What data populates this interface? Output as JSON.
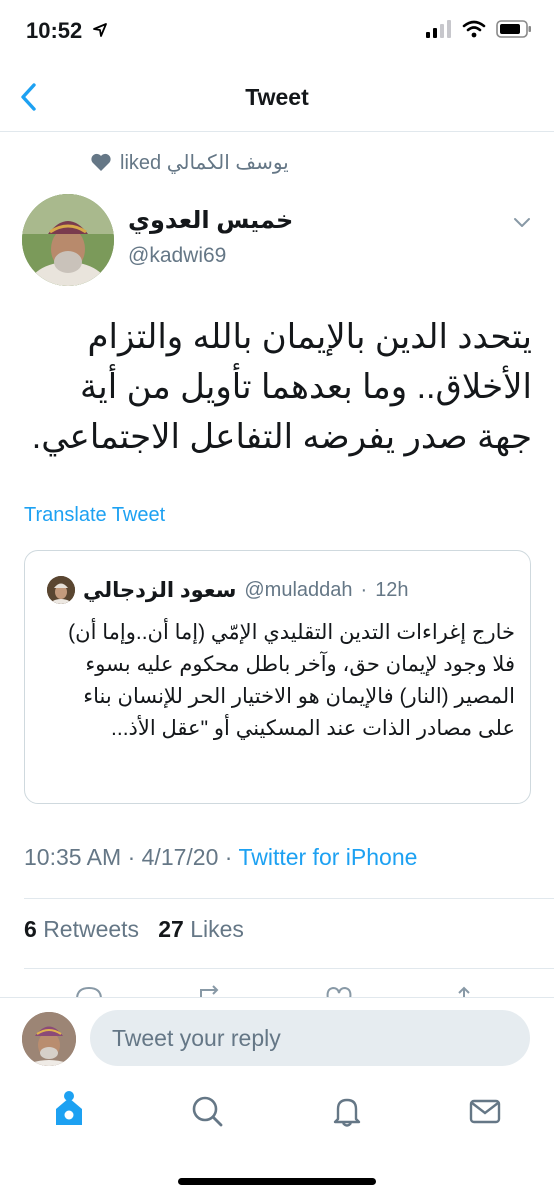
{
  "status_bar": {
    "time": "10:52"
  },
  "nav": {
    "title": "Tweet"
  },
  "social_context": {
    "text": "liked يوسف الكمالي"
  },
  "author": {
    "name": "خميس العدوي",
    "handle": "@kadwi69"
  },
  "tweet": {
    "text": "يتحدد الدين بالإيمان بالله والتزام الأخلاق.. وما بعدهما تأويل من أية جهة صدر يفرضه التفاعل الاجتماعي.",
    "translate_label": "Translate Tweet"
  },
  "quoted_tweet": {
    "name": "سعود الزدجالي",
    "handle": "@muladdah",
    "separator": "·",
    "time": "12h",
    "text": "خارج إغراءات التدين التقليدي الإمّي (إما أن..وإما أن) فلا وجود لإيمان حق، وآخر باطل محكوم عليه بسوء المصير (النار) فالإيمان هو الاختيار الحر للإنسان بناء على مصادر الذات عند المسكيني أو \"عقل الأذ..."
  },
  "meta": {
    "time": "10:35 AM",
    "separator": "·",
    "date": "4/17/20",
    "source": "Twitter for iPhone"
  },
  "stats": {
    "retweets_count": "6",
    "retweets_label": "Retweets",
    "likes_count": "27",
    "likes_label": "Likes"
  },
  "reply": {
    "placeholder": "Tweet your reply"
  },
  "tabs": [
    {
      "icon": "home-icon",
      "active": true
    },
    {
      "icon": "search-icon",
      "active": false
    },
    {
      "icon": "bell-icon",
      "active": false
    },
    {
      "icon": "mail-icon",
      "active": false
    }
  ],
  "colors": {
    "accent": "#1da1f2",
    "secondary_text": "#657786",
    "primary_text": "#14171a",
    "divider": "#e1e8ed"
  }
}
